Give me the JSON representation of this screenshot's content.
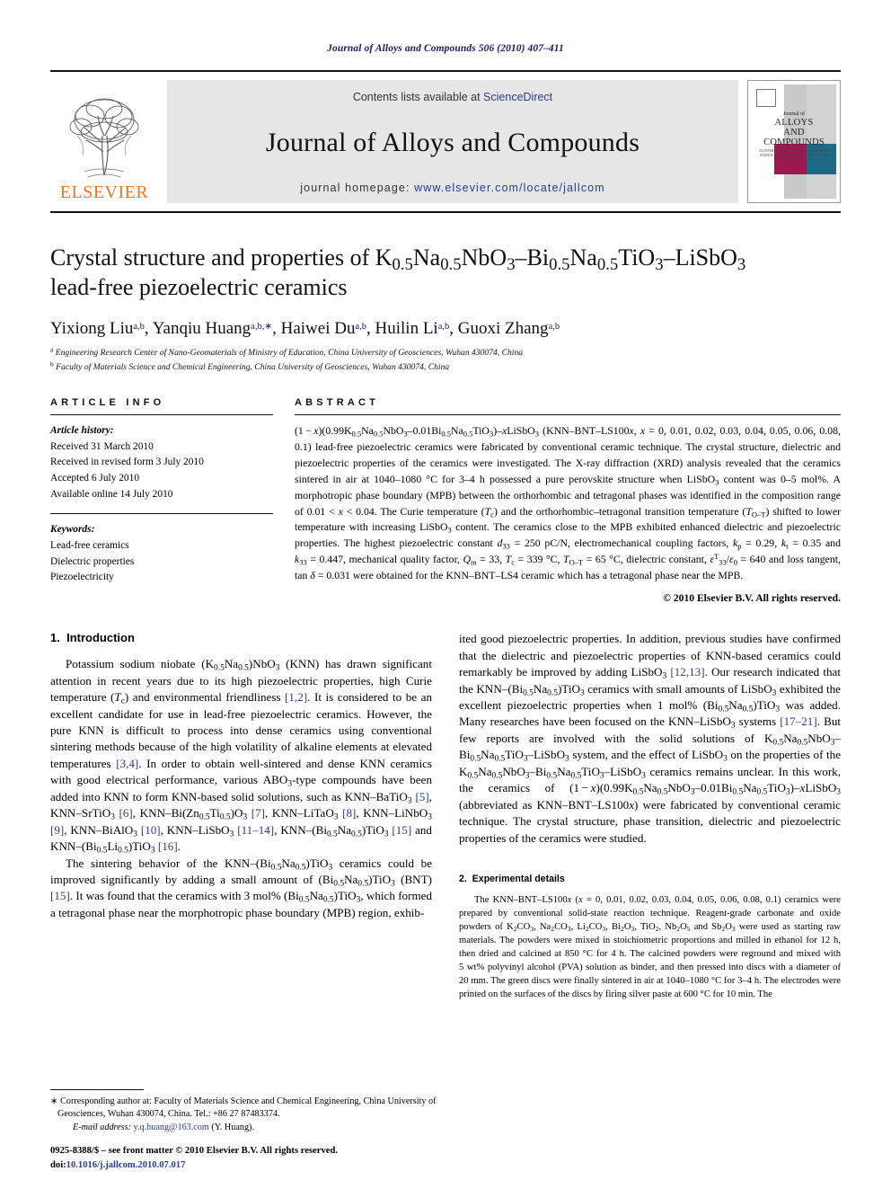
{
  "running_head": "Journal of Alloys and Compounds 506 (2010) 407–411",
  "masthead": {
    "publisher": "ELSEVIER",
    "contents_prefix": "Contents lists available at ",
    "contents_link": "ScienceDirect",
    "journal_name": "Journal of Alloys and Compounds",
    "homepage_prefix": "journal homepage: ",
    "homepage_url": "www.elsevier.com/locate/jallcom",
    "cover": {
      "line1": "Journal of",
      "line2": "ALLOYS",
      "line3": "AND COMPOUNDS",
      "line4": "AN INTERNATIONAL JOURNAL OF MATERIALS SCIENCE AND SOLID-STATE CHEMISTRY AND PHYSICS",
      "color_magenta": "#9e1750",
      "color_teal": "#1d6a85"
    }
  },
  "article": {
    "title_line1_pre": "Crystal structure and properties of K",
    "title_full": "Crystal structure and properties of K0.5Na0.5NbO3–Bi0.5Na0.5TiO3–LiSbO3 lead-free piezoelectric ceramics",
    "title_line2": "lead-free piezoelectric ceramics",
    "authors": "Yixiong Liu, Yanqiu Huang, Haiwei Du, Huilin Li, Guoxi Zhang",
    "affiliation_a": "Engineering Research Center of Nano-Geomaterials of Ministry of Education, China University of Geosciences, Wuhan 430074, China",
    "affiliation_b": "Faculty of Materials Science and Chemical Engineering, China University of Geosciences, Wuhan 430074, China"
  },
  "article_info": {
    "heading": "ARTICLE INFO",
    "history_label": "Article history:",
    "history": [
      "Received 31 March 2010",
      "Received in revised form 3 July 2010",
      "Accepted 6 July 2010",
      "Available online 14 July 2010"
    ],
    "keywords_label": "Keywords:",
    "keywords": [
      "Lead-free ceramics",
      "Dielectric properties",
      "Piezoelectricity"
    ]
  },
  "abstract": {
    "heading": "ABSTRACT",
    "copyright": "© 2010 Elsevier B.V. All rights reserved."
  },
  "sections": {
    "intro_number": "1.",
    "intro_title": "Introduction",
    "experimental_number": "2.",
    "experimental_title": "Experimental details"
  },
  "footnote": {
    "star": "∗",
    "text_lead": " Corresponding author at: Faculty of Materials Science and Chemical Engineering, China University of Geosciences, Wuhan 430074, China. Tel.: +86 27 87483374.",
    "email_label": "E-mail address:",
    "email": "y.q.huang@163.com",
    "email_suffix": "(Y. Huang)."
  },
  "footer": {
    "issn_line": "0925-8388/$ – see front matter © 2010 Elsevier B.V. All rights reserved.",
    "doi_label": "doi:",
    "doi_value": "10.1016/j.jallcom.2010.07.017"
  }
}
